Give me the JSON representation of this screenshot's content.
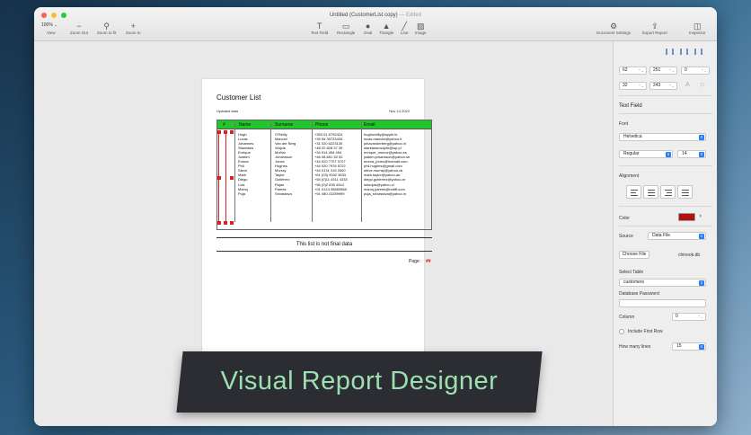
{
  "window": {
    "title": "Untitled (CustomerList copy)",
    "title_sep": "—",
    "edited": "Edited"
  },
  "toolbar": {
    "zoom_value": "100%",
    "view_label": "View",
    "zoom_out_label": "Zoom Out",
    "zoom_fit_label": "Zoom to fit",
    "zoom_in_label": "Zoom In",
    "text_field_label": "Text Field",
    "rectangle_label": "Rectangle",
    "oval_label": "Oval",
    "triangle_label": "Triangle",
    "line_label": "Line",
    "image_label": "Image",
    "doc_settings_label": "Document Settings",
    "export_label": "Export Report",
    "inspector_label": "Inspector"
  },
  "report": {
    "title": "Customer List",
    "subtitle": "Updated data",
    "date": "Nov 14 2022",
    "columns": [
      "#",
      "Name",
      "Surname",
      "Phone",
      "Email"
    ],
    "names": [
      "Hugh",
      "Lucas",
      "Johannes",
      "Stanisław",
      "Enrique",
      "Joakim",
      "Emma",
      "Phil",
      "Steve",
      "Mark",
      "Diego",
      "Luis",
      "Manoj",
      "Puja"
    ],
    "surnames": [
      "O'Reilly",
      "Mancini",
      "Van der Berg",
      "Wójcik",
      "Muñoz",
      "Johansson",
      "Jones",
      "Hughes",
      "Murray",
      "Taylor",
      "Gutiérrez",
      "Rojas",
      "Pareek",
      "Srivastava"
    ],
    "phones": [
      "+353 01 6792424",
      "+39 06 39733434",
      "+31 020 6223130",
      "+48 22 828 37 39",
      "+34 914 454 454",
      "+46 08-651 52 52",
      "+44 020 7707 0707",
      "+44 020 7976 5722",
      "+44 0131 315 3300",
      "+61 (03) 9332 3633",
      "+54 (0)11 4311 4333",
      "+56 (0)2 635 4444",
      "+91 0124 39883988",
      "+91 080 22289999"
    ],
    "emails": [
      "hughoreilly@apple.ie",
      "lucas.mancini@yahoo.it",
      "johavanderberg@yahoo.nl",
      "stanisław.wójcik@wp.pl",
      "enrique_munoz@yahoo.es",
      "joakim.johansson@yahoo.se",
      "emma_jones@hotmail.com",
      "phil.hughes@gmail.com",
      "steve.murray@yahoo.uk",
      "mark.taylor@yahoo.au",
      "diego.gutierrez@yahoo.ar",
      "luisrojas@yahoo.cl",
      "manoj.pareek@rediff.com",
      "puja_srivastava@yahoo.in"
    ],
    "note": "This list is not final data",
    "page_label": "Page:",
    "page_value": "##"
  },
  "banner": {
    "text": "Visual Report Designer"
  },
  "inspector": {
    "x": "62",
    "y": "251",
    "w": "0",
    "rot": "32",
    "h": "243",
    "section_title": "Text Field",
    "font_label": "Font",
    "font_family": "Helvetica",
    "font_style": "Regular",
    "font_size": "14",
    "alignment_label": "Alignment",
    "color_label": "Color",
    "color_value": "#b01212",
    "source_label": "Source",
    "source_value": "Data File",
    "choose_file_label": "Choose File",
    "file_name": "chinook.db",
    "select_table_label": "Select Table",
    "table_value": "customers",
    "db_password_label": "Database Password",
    "column_label": "Column",
    "column_value": "0",
    "include_first_row_label": "Include First Row",
    "how_many_lines_label": "How many lines",
    "how_many_lines_value": "15"
  }
}
